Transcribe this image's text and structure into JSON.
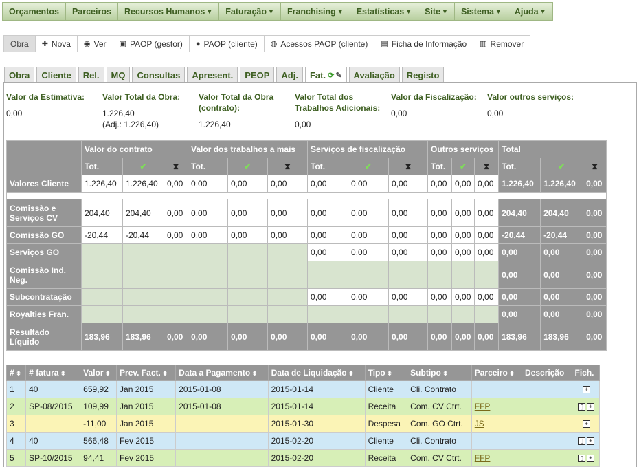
{
  "menu": [
    "Orçamentos",
    "Parceiros",
    "Recursos Humanos",
    "Faturação",
    "Franchising",
    "Estatísticas",
    "Site",
    "Sistema",
    "Ajuda"
  ],
  "menu_dropdown": [
    false,
    false,
    true,
    true,
    true,
    true,
    true,
    true,
    true
  ],
  "toolbar": {
    "items": [
      {
        "label": "Obra",
        "icon": ""
      },
      {
        "label": "Nova",
        "icon": "plus-icon"
      },
      {
        "label": "Ver",
        "icon": "eye-icon"
      },
      {
        "label": "PAOP (gestor)",
        "icon": "briefcase-icon"
      },
      {
        "label": "PAOP (cliente)",
        "icon": "user-icon"
      },
      {
        "label": "Acessos PAOP (cliente)",
        "icon": "globe-icon"
      },
      {
        "label": "Ficha de Informação",
        "icon": "document-icon"
      },
      {
        "label": "Remover",
        "icon": "trash-icon"
      }
    ]
  },
  "tabs": [
    "Obra",
    "Cliente",
    "Rel.",
    "MQ",
    "Consultas",
    "Apresent.",
    "PEOP",
    "Adj.",
    "Fat.",
    "Avaliação",
    "Registo"
  ],
  "active_tab": "Fat.",
  "summary": [
    {
      "label": "Valor da Estimativa:",
      "value": "0,00",
      "sub": ""
    },
    {
      "label": "Valor Total da Obra:",
      "value": "1.226,40",
      "sub": "(Adj.: 1.226,40)"
    },
    {
      "label": "Valor Total da Obra (contrato):",
      "value": "1.226,40",
      "sub": ""
    },
    {
      "label": "Valor Total dos Trabalhos Adicionais:",
      "value": "0,00",
      "sub": ""
    },
    {
      "label": "Valor da Fiscalização:",
      "value": "0,00",
      "sub": ""
    },
    {
      "label": "Valor outros serviços:",
      "value": "0,00",
      "sub": ""
    }
  ],
  "fin": {
    "groups": [
      "Valor do contrato",
      "Valor dos trabalhos a mais",
      "Serviços de fiscalização",
      "Outros serviços",
      "Total"
    ],
    "subheaders": [
      "Tot.",
      "✔",
      "⧗"
    ],
    "rows": [
      {
        "label": "Valores Cliente",
        "cells": [
          "1.226,40",
          "1.226,40",
          "0,00",
          "0,00",
          "0,00",
          "0,00",
          "0,00",
          "0,00",
          "0,00",
          "0,00",
          "0,00",
          "0,00",
          "1.226,40",
          "1.226,40",
          "0,00"
        ]
      },
      {
        "label": "Comissão e Serviços CV",
        "cells": [
          "204,40",
          "204,40",
          "0,00",
          "0,00",
          "0,00",
          "0,00",
          "0,00",
          "0,00",
          "0,00",
          "0,00",
          "0,00",
          "0,00",
          "204,40",
          "204,40",
          "0,00"
        ]
      },
      {
        "label": "Comissão GO",
        "cells": [
          "-20,44",
          "-20,44",
          "0,00",
          "0,00",
          "0,00",
          "0,00",
          "0,00",
          "0,00",
          "0,00",
          "0,00",
          "0,00",
          "0,00",
          "-20,44",
          "-20,44",
          "0,00"
        ]
      },
      {
        "label": "Serviços GO",
        "cells": [
          "",
          "",
          "",
          "",
          "",
          "",
          "0,00",
          "0,00",
          "0,00",
          "0,00",
          "0,00",
          "0,00",
          "0,00",
          "0,00",
          "0,00"
        ]
      },
      {
        "label": "Comissão Ind. Neg.",
        "cells": [
          "",
          "",
          "",
          "",
          "",
          "",
          "",
          "",
          "",
          "",
          "",
          "",
          "0,00",
          "0,00",
          "0,00"
        ]
      },
      {
        "label": "Subcontratação",
        "cells": [
          "",
          "",
          "",
          "",
          "",
          "",
          "0,00",
          "0,00",
          "0,00",
          "0,00",
          "0,00",
          "0,00",
          "0,00",
          "0,00",
          "0,00"
        ]
      },
      {
        "label": "Royalties Fran.",
        "cells": [
          "",
          "",
          "",
          "",
          "",
          "",
          "",
          "",
          "",
          "",
          "",
          "",
          "0,00",
          "0,00",
          "0,00"
        ]
      },
      {
        "label": "Resultado Líquido",
        "cells": [
          "183,96",
          "183,96",
          "0,00",
          "0,00",
          "0,00",
          "0,00",
          "0,00",
          "0,00",
          "0,00",
          "0,00",
          "0,00",
          "0,00",
          "183,96",
          "183,96",
          "0,00"
        ]
      }
    ]
  },
  "invoices": {
    "headers": [
      "#",
      "# fatura",
      "Valor",
      "Prev. Fact.",
      "Data a Pagamento",
      "Data de Liquidação",
      "Tipo",
      "Subtipo",
      "Parceiro",
      "Descrição",
      "Fich."
    ],
    "rows": [
      {
        "color": "blue",
        "cells": [
          "1",
          "40",
          "659,92",
          "Jan 2015",
          "2015-01-08",
          "2015-01-14",
          "Cliente",
          "Cli. Contrato",
          "",
          ""
        ],
        "file": false
      },
      {
        "color": "green",
        "cells": [
          "2",
          "SP-08/2015",
          "109,99",
          "Jan 2015",
          "2015-01-08",
          "2015-01-14",
          "Receita",
          "Com. CV Ctrt.",
          "FFP",
          ""
        ],
        "file": true
      },
      {
        "color": "yellow",
        "cells": [
          "3",
          "",
          "-11,00",
          "Jan 2015",
          "",
          "2015-01-30",
          "Despesa",
          "Com. GO Ctrt.",
          "JS",
          ""
        ],
        "file": false
      },
      {
        "color": "blue",
        "cells": [
          "4",
          "40",
          "566,48",
          "Fev 2015",
          "",
          "2015-02-20",
          "Cliente",
          "Cli. Contrato",
          "",
          ""
        ],
        "file": true
      },
      {
        "color": "green",
        "cells": [
          "5",
          "SP-10/2015",
          "94,41",
          "Fev 2015",
          "",
          "2015-02-20",
          "Receita",
          "Com. CV Ctrt.",
          "FFP",
          ""
        ],
        "file": true
      }
    ]
  }
}
